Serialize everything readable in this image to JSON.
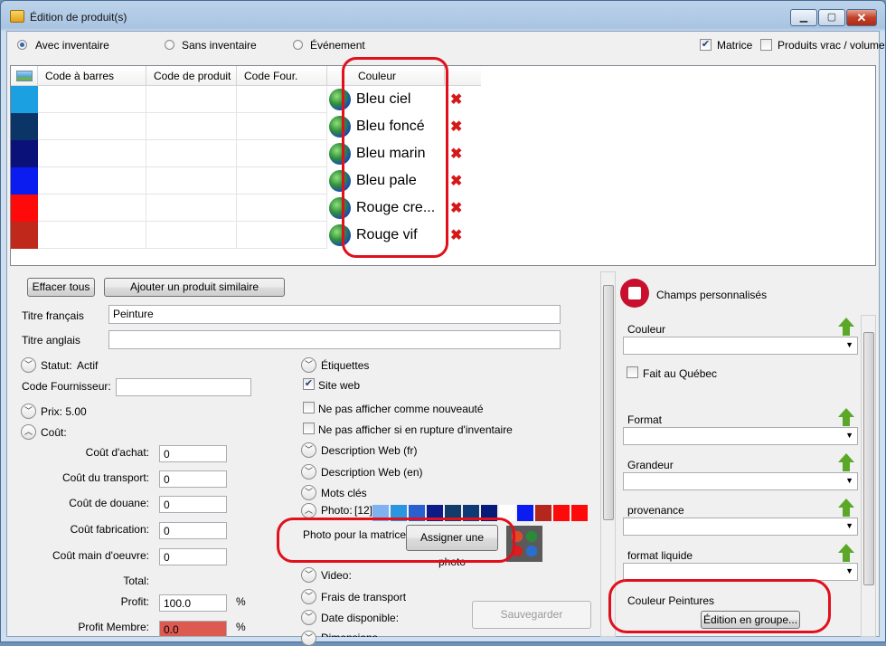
{
  "window": {
    "title": "Édition de produit(s)"
  },
  "topbar": {
    "radios": [
      {
        "label": "Avec inventaire",
        "checked": true
      },
      {
        "label": "Sans inventaire",
        "checked": false
      },
      {
        "label": "Événement",
        "checked": false
      }
    ],
    "matrice_label": "Matrice",
    "matrice_checked": true,
    "vrac_label": "Produits vrac / volume",
    "vrac_checked": false
  },
  "grid": {
    "columns": [
      "Code à barres",
      "Code de produit",
      "Code Four.",
      "Couleur Peintures"
    ],
    "rows": [
      {
        "color": "#1ba1e2",
        "name": "Bleu ciel"
      },
      {
        "color": "#0b3566",
        "name": "Bleu foncé"
      },
      {
        "color": "#0a127a",
        "name": "Bleu marin"
      },
      {
        "color": "#0a1cf0",
        "name": "Bleu pale"
      },
      {
        "color": "#ff0a0a",
        "name": "Rouge cre..."
      },
      {
        "color": "#c0281c",
        "name": "Rouge vif"
      }
    ],
    "delete_glyph": "✖"
  },
  "form": {
    "clear_all": "Effacer tous",
    "add_similar": "Ajouter un produit similaire",
    "titre_fr_label": "Titre français",
    "titre_fr_value": "Peinture",
    "titre_en_label": "Titre anglais",
    "titre_en_value": "",
    "statut_label": "Statut:",
    "statut_value": "Actif",
    "code_four_label": "Code Fournisseur:",
    "code_four_value": "",
    "prix": "Prix: 5.00",
    "cout": "Coût:",
    "costs": [
      {
        "label": "Coût d'achat:",
        "value": "0"
      },
      {
        "label": "Coût du transport:",
        "value": "0"
      },
      {
        "label": "Coût de douane:",
        "value": "0"
      },
      {
        "label": "Coût fabrication:",
        "value": "0"
      },
      {
        "label": "Coût main d'oeuvre:",
        "value": "0"
      }
    ],
    "total_label": "Total:",
    "profit_label": "Profit:",
    "profit_value": "100.0",
    "profit_unit": "%",
    "profit_membre_label": "Profit Membre:",
    "profit_membre_value": "0.0",
    "profit_membre_unit": "%"
  },
  "middle": {
    "etiquettes": "Étiquettes",
    "site_web": "Site web",
    "site_web_checked": true,
    "nouveaute": "Ne pas afficher comme nouveauté",
    "rupture": "Ne pas afficher si en rupture d'inventaire",
    "desc_fr": "Description Web (fr)",
    "desc_en": "Description Web (en)",
    "mots_cles": "Mots clés",
    "photo_label": "Photo:",
    "photo_count": "[12]",
    "photo_colors": [
      "#7fb2f0",
      "#2a95e0",
      "#2a5fd0",
      "#0d1b88",
      "#123c6a",
      "#0e3a78",
      "#061a7a",
      "#ffffff",
      "#0a1cf0",
      "#b5261c",
      "#ff0a0a",
      "#ff0a0a"
    ],
    "photo_matrice": "Photo pour la matrice",
    "assign_photo": "Assigner une photo",
    "video": "Video:",
    "frais": "Frais de transport",
    "date": "Date disponible:",
    "dimensions": "Dimensions",
    "save": "Sauvegarder"
  },
  "custom": {
    "title": "Champs personnalisés",
    "couleur": "Couleur",
    "fait_qc": "Fait au Québec",
    "format": "Format",
    "grandeur": "Grandeur",
    "provenance": "provenance",
    "format_liquide": "format liquide",
    "couleur_peintures": "Couleur Peintures",
    "edition_groupe": "Édition en groupe..."
  }
}
